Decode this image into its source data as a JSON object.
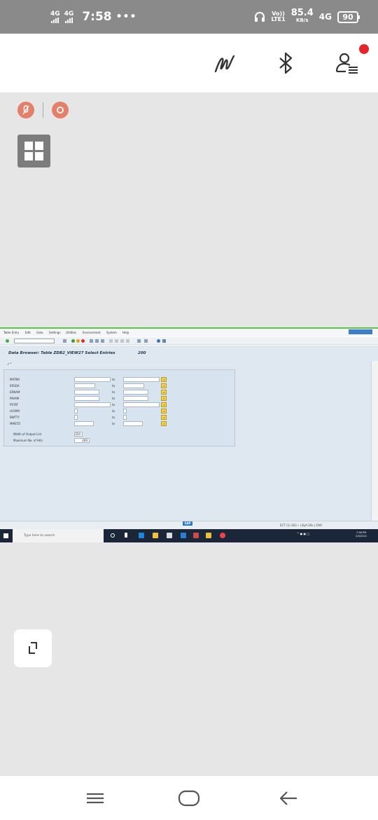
{
  "status_bar": {
    "network_1": "4G",
    "network_2": "4G",
    "time": "7:58",
    "more_indicator": "•••",
    "volte_top": "Vo))",
    "volte_bottom": "LTE1",
    "speed_value": "85.4",
    "speed_unit": "KB/s",
    "network_3": "4G",
    "battery": "90",
    "icons": [
      "headset-icon",
      "signal-icon",
      "battery-icon"
    ]
  },
  "app_bar": {
    "icons": [
      "scribble-pen-icon",
      "bluetooth-icon",
      "user-menu-icon"
    ],
    "notification_color": "#e8242b"
  },
  "floating_controls": {
    "icons": [
      "mic-off-icon",
      "record-icon",
      "grid-menu-icon",
      "crop-icon"
    ],
    "accent": "#e4806a"
  },
  "sap_screen": {
    "menu": [
      "Table Entry",
      "Edit",
      "Goto",
      "Settings",
      "Utilities",
      "Environment",
      "System",
      "Help"
    ],
    "title": "Data Browser: Table ZDB2_VIEW27 Select Entries",
    "title_count": "200",
    "execute_icon": "✓¹",
    "to_label": "to",
    "fields": [
      {
        "name": "MATNR"
      },
      {
        "name": "ERSDA"
      },
      {
        "name": "ERNAM"
      },
      {
        "name": "PAVAM"
      },
      {
        "name": "PSTAT"
      },
      {
        "name": "LVORM"
      },
      {
        "name": "BWTTY"
      },
      {
        "name": "MMSTD"
      }
    ],
    "extra_fields": [
      {
        "name": "Width of Output List",
        "value": "250"
      },
      {
        "name": "Maximum No. of Hits",
        "value": "200"
      }
    ],
    "sap_logo": "SAP",
    "status_text": "ECT (1) 363 • | ByA-20s | OVR",
    "taskbar_search": "Type here to search",
    "clock_time": "7:58 PM",
    "clock_date": "2/4/2021"
  },
  "nav_bar": {
    "icons": [
      "recent-apps-icon",
      "home-icon",
      "back-icon"
    ]
  }
}
